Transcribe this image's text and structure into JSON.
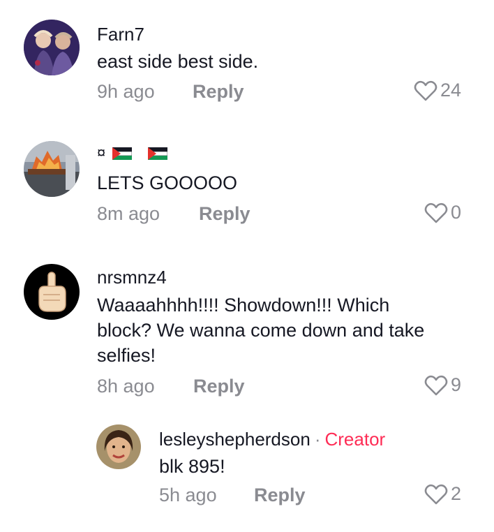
{
  "comments": [
    {
      "username": "Farn7",
      "text": "east side best side.",
      "time": "9h ago",
      "reply_label": "Reply",
      "likes": "24",
      "avatar": "group-photo-avatar"
    },
    {
      "username": "¤",
      "text": "LETS GOOOOO",
      "time": "8m ago",
      "reply_label": "Reply",
      "likes": "0",
      "avatar": "fire-scene-avatar",
      "flags": [
        "palestine-flag",
        "palestine-flag"
      ]
    },
    {
      "username": "nrsmnz4",
      "text_lines": [
        "Waaaahhhh!!!! Showdown!!! Which",
        "block? We wanna come down and take",
        "selfies!"
      ],
      "time": "8h ago",
      "reply_label": "Reply",
      "likes": "9",
      "avatar": "pointing-finger-avatar"
    }
  ],
  "reply_thread": {
    "username": "lesleyshepherdson",
    "separator": "·",
    "badge": "Creator",
    "text": "blk 895!",
    "time": "5h ago",
    "reply_label": "Reply",
    "likes": "2",
    "avatar": "woman-portrait-avatar"
  },
  "colors": {
    "text": "#161823",
    "muted": "#8a8b91",
    "creator": "#fe2c55"
  },
  "icons": {
    "like": "heart-outline-icon"
  }
}
